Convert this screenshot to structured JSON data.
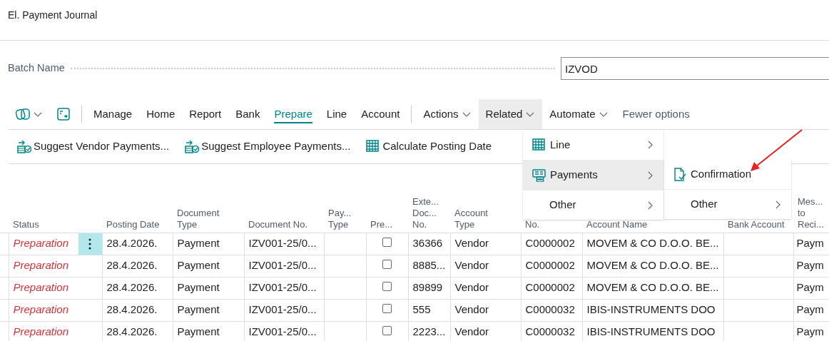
{
  "page": {
    "title": "El. Payment Journal"
  },
  "batch": {
    "label": "Batch Name",
    "value": "IZVOD"
  },
  "toolbar": {
    "tabs": [
      {
        "label": "Manage",
        "selected": false
      },
      {
        "label": "Home",
        "selected": false
      },
      {
        "label": "Report",
        "selected": false
      },
      {
        "label": "Bank",
        "selected": false
      },
      {
        "label": "Prepare",
        "selected": true
      },
      {
        "label": "Line",
        "selected": false
      },
      {
        "label": "Account",
        "selected": false
      }
    ],
    "menus": [
      {
        "label": "Actions",
        "expanded": false
      },
      {
        "label": "Related",
        "expanded": true
      },
      {
        "label": "Automate",
        "expanded": false
      }
    ],
    "fewer_options": "Fewer options"
  },
  "actions": [
    "Suggest Vendor Payments...",
    "Suggest Employee Payments...",
    "Calculate Posting Date"
  ],
  "related_menu": [
    {
      "label": "Line",
      "selected": false
    },
    {
      "label": "Payments",
      "selected": true
    },
    {
      "label": "Other",
      "selected": false
    }
  ],
  "submenu": [
    {
      "label": "Confirmation",
      "kind": "action"
    },
    {
      "label": "Other",
      "kind": "submenu"
    }
  ],
  "table": {
    "columns": [
      "",
      "Status",
      "",
      "Posting Date",
      "Document\nType",
      "Document No.",
      "Pay...\nType",
      "Pre...",
      "Exte...\nDoc...\nNo.",
      "Account\nType",
      "No.",
      "Account Name",
      "Bank Account",
      "Mes...\nto\nReci..."
    ],
    "rows": [
      {
        "selected": true,
        "status": "Preparation",
        "posting_date": "28.4.2026.",
        "document_type": "Payment",
        "document_no": "IZV001-25/0...",
        "checked": false,
        "external_doc_no": "36366",
        "account_type": "Vendor",
        "account_no": "C0000002",
        "account_name": "MOVEM & CO D.O.O. BE...",
        "message": "Paym"
      },
      {
        "selected": false,
        "status": "Preparation",
        "posting_date": "28.4.2026.",
        "document_type": "Payment",
        "document_no": "IZV001-25/0...",
        "checked": false,
        "external_doc_no": "8885...",
        "account_type": "Vendor",
        "account_no": "C0000002",
        "account_name": "MOVEM & CO D.O.O. BE...",
        "message": "Paym"
      },
      {
        "selected": false,
        "status": "Preparation",
        "posting_date": "28.4.2026.",
        "document_type": "Payment",
        "document_no": "IZV001-25/0...",
        "checked": false,
        "external_doc_no": "89899",
        "account_type": "Vendor",
        "account_no": "C0000002",
        "account_name": "MOVEM & CO D.O.O. BE...",
        "message": "Paym"
      },
      {
        "selected": false,
        "status": "Preparation",
        "posting_date": "28.4.2026.",
        "document_type": "Payment",
        "document_no": "IZV001-25/0...",
        "checked": false,
        "external_doc_no": "555",
        "account_type": "Vendor",
        "account_no": "C0000032",
        "account_name": "IBIS-INSTRUMENTS DOO",
        "message": "Paym"
      },
      {
        "selected": false,
        "status": "Preparation",
        "posting_date": "28.4.2026.",
        "document_type": "Payment",
        "document_no": "IZV001-25/0...",
        "checked": false,
        "external_doc_no": "2223...",
        "account_type": "Vendor",
        "account_no": "C0000032",
        "account_name": "IBIS-INSTRUMENTS DOO",
        "message": "Paym"
      }
    ]
  }
}
